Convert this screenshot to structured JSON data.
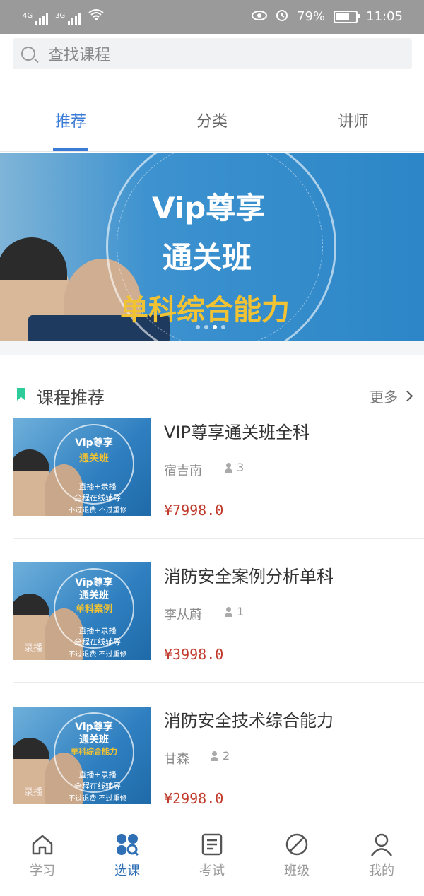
{
  "status": {
    "network": "4G",
    "network2": "3G",
    "battery": "79%",
    "time": "11:05"
  },
  "search": {
    "placeholder": "查找课程"
  },
  "tabs": [
    {
      "label": "推荐",
      "active": true
    },
    {
      "label": "分类",
      "active": false
    },
    {
      "label": "讲师",
      "active": false
    }
  ],
  "banner": {
    "line1": "Vip尊享",
    "line2": "通关班",
    "line3": "单科综合能力",
    "page_count": 4,
    "active_page": 3
  },
  "section": {
    "title": "课程推荐",
    "more": "更多"
  },
  "courses": [
    {
      "title": "VIP尊享通关班全科",
      "teacher": "宿吉南",
      "students": "3",
      "price": "¥7998.0",
      "thumb": {
        "t1": "Vip尊享",
        "t2": "通关班",
        "line1": "直播+录播",
        "line2": "全程在线辅导",
        "line3": "不过退费  不过重修"
      }
    },
    {
      "title": "消防安全案例分析单科",
      "teacher": "李从蔚",
      "students": "1",
      "price": "¥3998.0",
      "thumb": {
        "t1": "Vip尊享",
        "t2": "通关班",
        "t3": "单科案例",
        "tag": "录播",
        "line1": "直播+录播",
        "line2": "全程在线辅导",
        "line3": "不过退费  不过重修"
      }
    },
    {
      "title": "消防安全技术综合能力",
      "teacher": "甘森",
      "students": "2",
      "price": "¥2998.0",
      "thumb": {
        "t1": "Vip尊享",
        "t2": "通关班",
        "t3": "单科综合能力",
        "tag": "录播",
        "line1": "直播+录播",
        "line2": "全程在线辅导",
        "line3": "不过退费  不过重修"
      }
    }
  ],
  "nav": [
    {
      "label": "学习",
      "icon": "home-icon"
    },
    {
      "label": "选课",
      "icon": "grid-search-icon",
      "active": true
    },
    {
      "label": "考试",
      "icon": "exam-icon"
    },
    {
      "label": "班级",
      "icon": "class-icon"
    },
    {
      "label": "我的",
      "icon": "user-icon"
    }
  ],
  "colors": {
    "accent": "#3a7bd5",
    "price": "#c0392b",
    "bookmark": "#2ecc9b",
    "nav_active": "#2f6fb5"
  }
}
